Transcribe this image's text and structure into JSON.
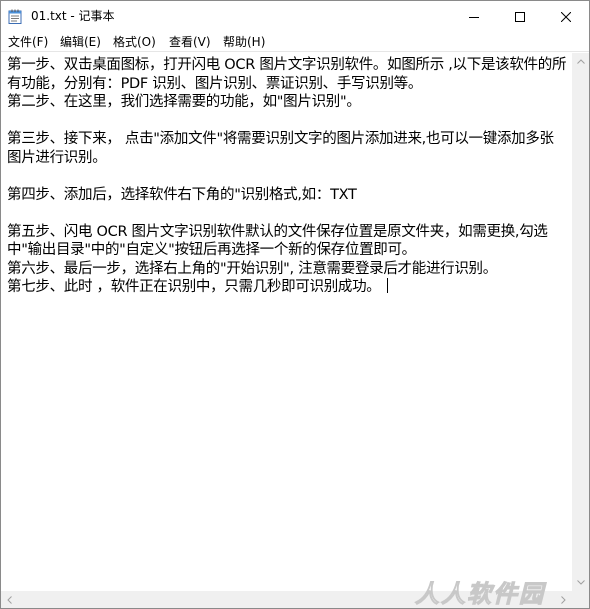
{
  "window": {
    "title": "01.txt - 记事本"
  },
  "menu": {
    "file": "文件(F)",
    "edit": "编辑(E)",
    "format": "格式(O)",
    "view": "查看(V)",
    "help": "帮助(H)"
  },
  "editor": {
    "content": "第一步、双击桌面图标，打开闪电 OCR 图片文字识别软件。如图所示 ,以下是该软件的所有功能，分别有：PDF 识别、图片识别、票证识别、手写识别等。\n第二步、在这里，我们选择需要的功能，如\"图片识别\"。\n\n第三步、接下来， 点击\"添加文件\"将需要识别文字的图片添加进来,也可以一键添加多张图片进行识别。\n\n第四步、添加后，选择软件右下角的\"识别格式,如：TXT\n\n第五步、闪电 OCR 图片文字识别软件默认的文件保存位置是原文件夹，如需更换,勾选中\"输出目录\"中的\"自定义\"按钮后再选择一个新的保存位置即可。\n第六步、最后一步，选择右上角的\"开始识别\", 注意需要登录后才能进行识别。\n第七步、此时 ，软件正在识别中，只需几秒即可识别成功。"
  },
  "watermark": {
    "text": "人人软件园"
  },
  "icons": {
    "app": "notepad-icon",
    "minimize": "minimize-icon",
    "maximize": "maximize-icon",
    "close": "close-icon"
  }
}
